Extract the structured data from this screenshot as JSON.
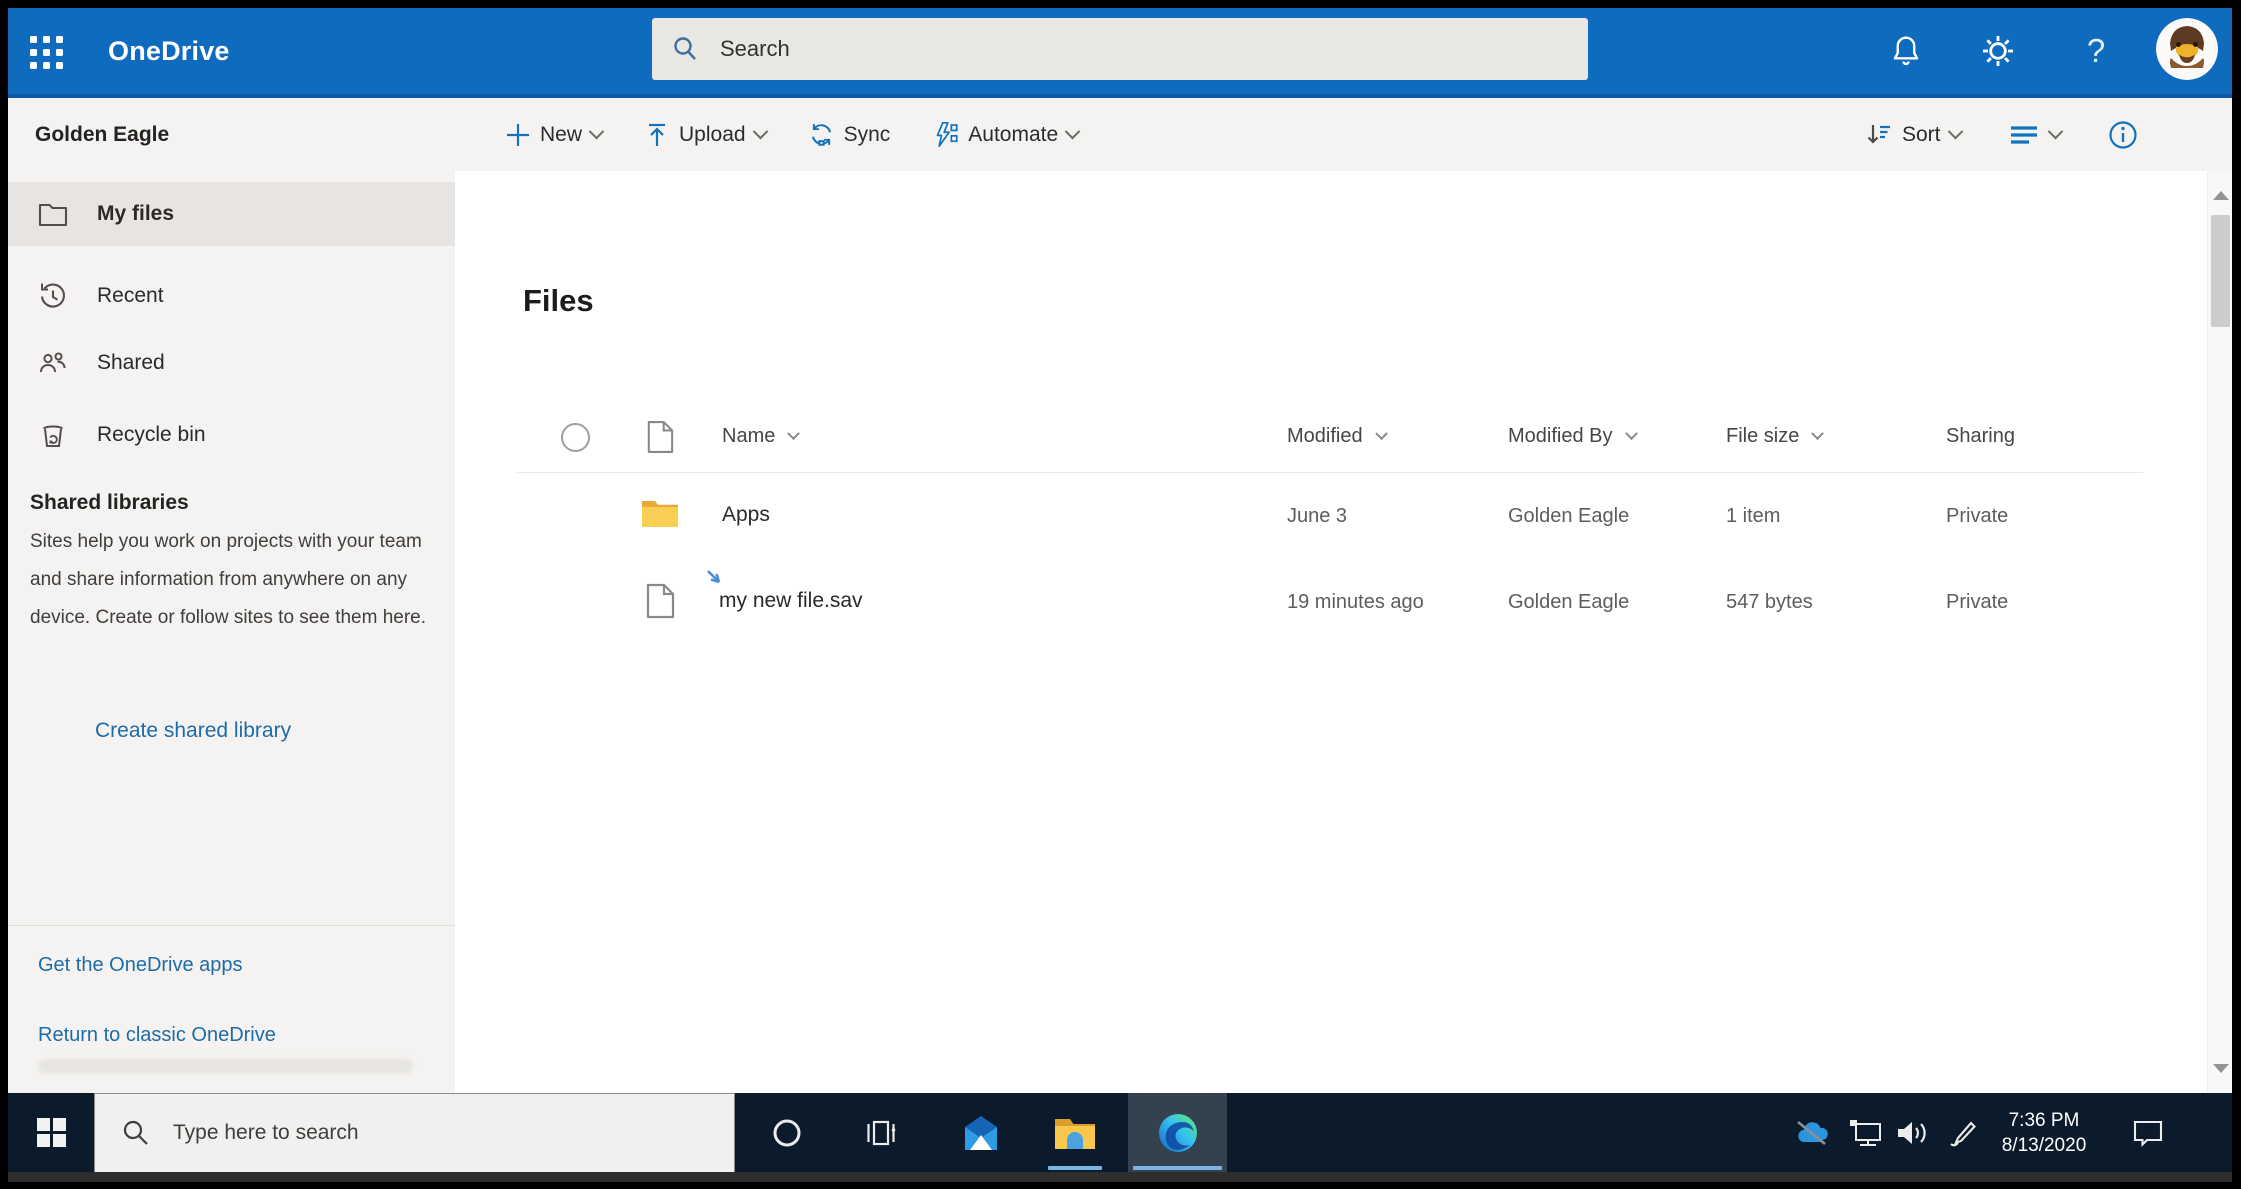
{
  "colors": {
    "suite_blue": "#0e6bbd",
    "accent_blue": "#1273bd",
    "link_blue": "#1e6ba8",
    "strip_gray": "#f5f3f1",
    "selected_gray": "#e7e4e1",
    "taskbar_navy": "#0c1b2b",
    "running_indicator": "#79b6e8",
    "folder_yellow": "#f8ce55"
  },
  "suite_bar": {
    "app_name": "OneDrive",
    "search": {
      "placeholder": "Search"
    },
    "help_glyph": "?"
  },
  "command_bar": {
    "library_name": "Golden Eagle",
    "actions": [
      {
        "label": "New",
        "has_dropdown": true
      },
      {
        "label": "Upload",
        "has_dropdown": true
      },
      {
        "label": "Sync",
        "has_dropdown": false
      },
      {
        "label": "Automate",
        "has_dropdown": true
      }
    ],
    "sort_label": "Sort"
  },
  "sidebar": {
    "nav": [
      {
        "label": "My files",
        "selected": true
      },
      {
        "label": "Recent",
        "selected": false
      },
      {
        "label": "Shared",
        "selected": false
      },
      {
        "label": "Recycle bin",
        "selected": false
      }
    ],
    "shared_libraries": {
      "heading": "Shared libraries",
      "description": "Sites help you work on projects with your team and share information from anywhere on any device. Create or follow sites to see them here.",
      "create_link": "Create shared library"
    },
    "footer_links": [
      "Get the OneDrive apps",
      "Return to classic OneDrive"
    ]
  },
  "main": {
    "title": "Files",
    "table": {
      "columns": [
        "Name",
        "Modified",
        "Modified By",
        "File size",
        "Sharing"
      ],
      "rows": [
        {
          "type": "folder",
          "name": "Apps",
          "modified": "June 3",
          "modified_by": "Golden Eagle",
          "file_size": "1 item",
          "sharing": "Private"
        },
        {
          "type": "file",
          "name": "my new file.sav",
          "modified": "19 minutes ago",
          "modified_by": "Golden Eagle",
          "file_size": "547 bytes",
          "sharing": "Private"
        }
      ]
    }
  },
  "taskbar": {
    "search_placeholder": "Type here to search",
    "clock": {
      "time": "7:36 PM",
      "date": "8/13/2020"
    }
  }
}
